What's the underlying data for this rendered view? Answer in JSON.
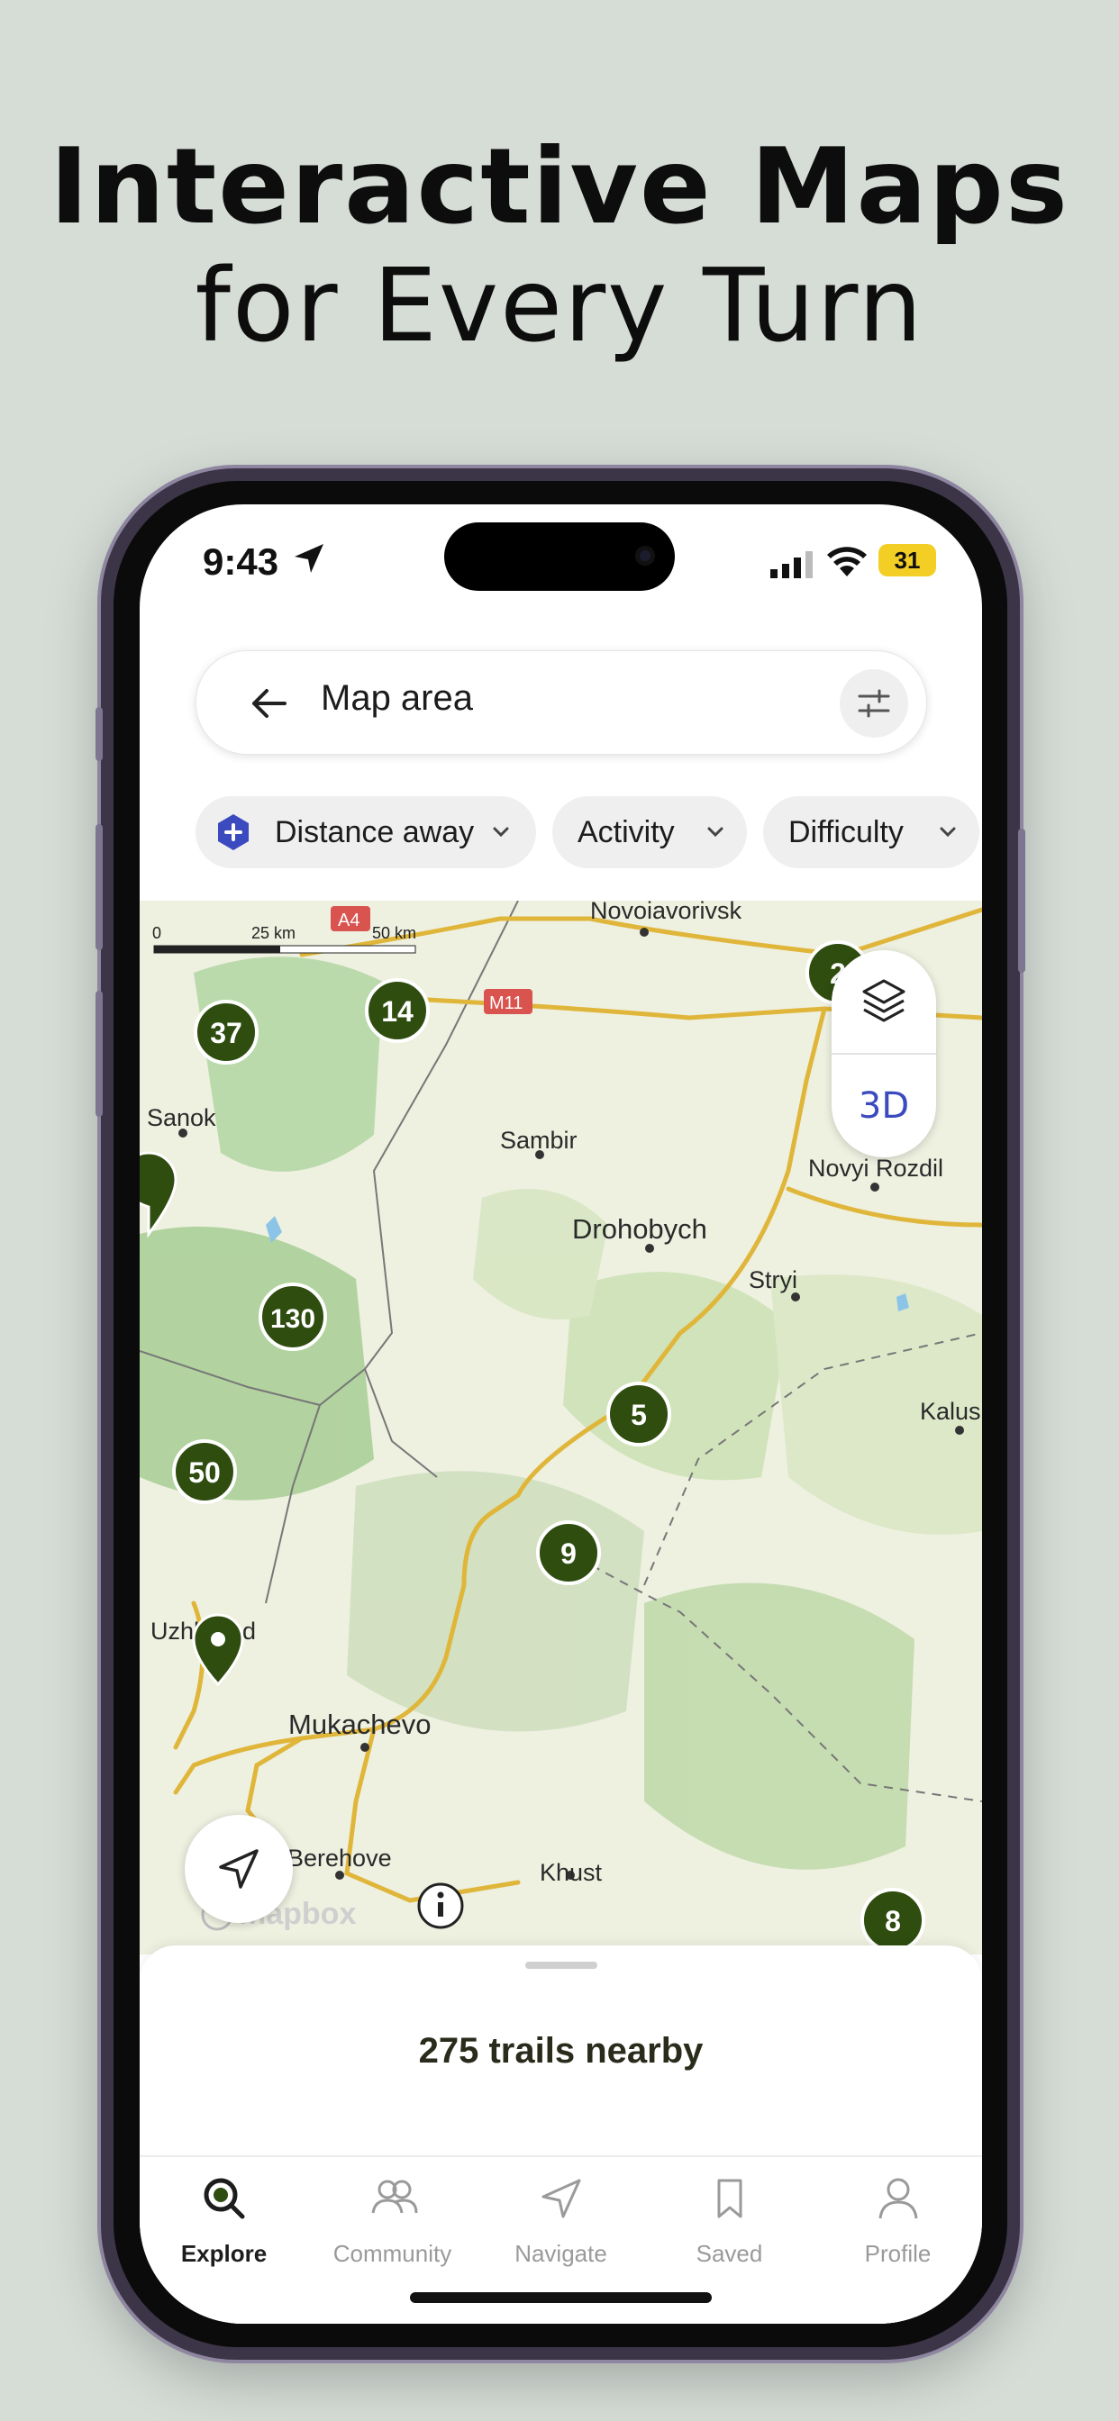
{
  "headline": {
    "line1": "Interactive Maps",
    "line2": "for Every Turn"
  },
  "status_bar": {
    "time": "9:43",
    "battery": "31"
  },
  "search": {
    "placeholder": "Map area"
  },
  "chips": [
    {
      "label": "Distance away"
    },
    {
      "label": "Activity"
    },
    {
      "label": "Difficulty"
    }
  ],
  "map": {
    "scale": {
      "zero": "0",
      "mid": "25 km",
      "end": "50 km"
    },
    "road_labels": [
      "A4",
      "M11"
    ],
    "places": [
      "Novoiavorivsk",
      "Sanok",
      "Sambir",
      "Drohobych",
      "Novyi Rozdil",
      "Stryi",
      "Kalus",
      "Uzhhorod",
      "Mukachevo",
      "Berehove",
      "Khust"
    ],
    "clusters": [
      "37",
      "14",
      "130",
      "50",
      "5",
      "9",
      "8",
      "2"
    ],
    "attribution": "mapbox",
    "three_d_label": "3D",
    "colors": {
      "marker": "#2e4d0f",
      "road": "#e0b63a",
      "forest": "#9cc98a"
    }
  },
  "sheet": {
    "trails_text": "275 trails nearby"
  },
  "tabs": [
    {
      "label": "Explore",
      "icon": "search-icon",
      "active": true
    },
    {
      "label": "Community",
      "icon": "people-icon",
      "active": false
    },
    {
      "label": "Navigate",
      "icon": "navigate-icon",
      "active": false
    },
    {
      "label": "Saved",
      "icon": "bookmark-icon",
      "active": false
    },
    {
      "label": "Profile",
      "icon": "person-icon",
      "active": false
    }
  ]
}
